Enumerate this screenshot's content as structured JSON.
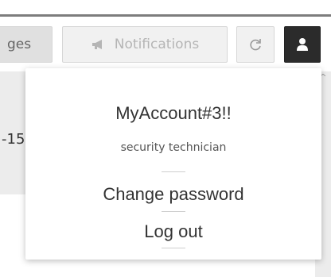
{
  "topbar": {
    "messages_label_partial": "ges",
    "notifications_label": "Notifications"
  },
  "background": {
    "left_partial_text": "-15"
  },
  "account_menu": {
    "username": "MyAccount#3!!",
    "role": "security technician",
    "change_password": "Change password",
    "log_out": "Log out"
  },
  "icons": {
    "notifications": "bullhorn-icon",
    "refresh": "refresh-icon",
    "account": "user-icon"
  }
}
